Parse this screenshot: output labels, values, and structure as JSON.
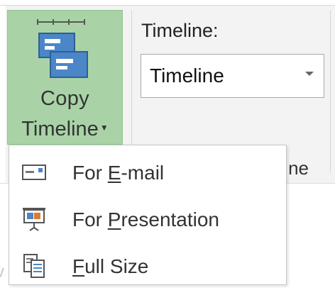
{
  "ribbon": {
    "copy_button": {
      "line1": "Copy",
      "line2": "Timeline",
      "icon": "copy-timeline-icon",
      "pressed_color": "#a9d3a6"
    },
    "timeline_label": "Timeline:",
    "timeline_combo": {
      "value": "Timeline"
    },
    "group_caption": "ne"
  },
  "menu": {
    "items": [
      {
        "label_pre": "For ",
        "accel": "E",
        "label_post": "-mail",
        "icon": "email-icon"
      },
      {
        "label_pre": "For ",
        "accel": "P",
        "label_post": "resentation",
        "icon": "presentation-icon"
      },
      {
        "label_pre": "",
        "accel": "F",
        "label_post": "ull Size",
        "icon": "full-size-icon"
      }
    ]
  },
  "background_fragment": "v"
}
